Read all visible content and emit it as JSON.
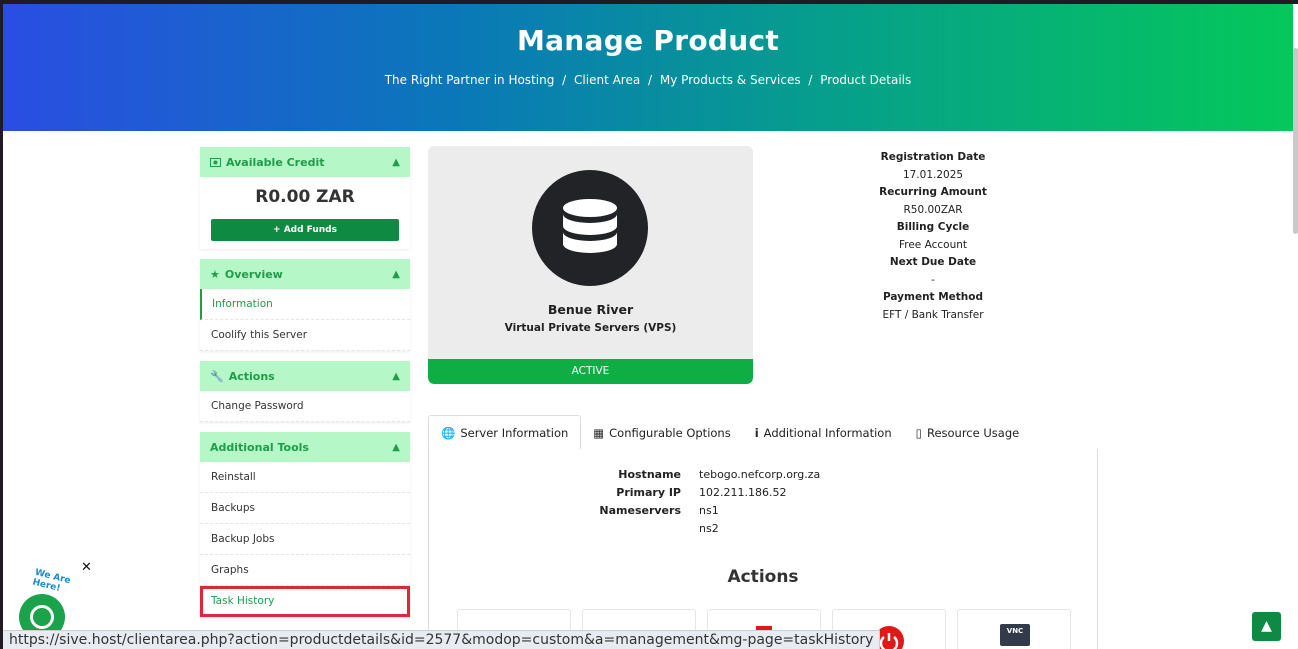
{
  "hero": {
    "title": "Manage Product",
    "breadcrumb": [
      "The Right Partner in Hosting",
      "Client Area",
      "My Products & Services",
      "Product Details"
    ],
    "separator": "/"
  },
  "sidebar": {
    "credit_panel": {
      "title": "Available Credit",
      "amount": "R0.00 ZAR",
      "button": "Add Funds"
    },
    "overview_panel": {
      "title": "Overview",
      "items": [
        "Information",
        "Coolify this Server"
      ]
    },
    "actions_panel": {
      "title": "Actions",
      "items": [
        "Change Password"
      ]
    },
    "tools_panel": {
      "title": "Additional Tools",
      "items": [
        "Reinstall",
        "Backups",
        "Backup Jobs",
        "Graphs",
        "Task History"
      ]
    }
  },
  "product": {
    "name": "Benue River",
    "group": "Virtual Private Servers (VPS)",
    "status": "ACTIVE"
  },
  "details": [
    {
      "label": "Registration Date",
      "value": "17.01.2025"
    },
    {
      "label": "Recurring Amount",
      "value": "R50.00ZAR"
    },
    {
      "label": "Billing Cycle",
      "value": "Free Account"
    },
    {
      "label": "Next Due Date",
      "value": "-"
    },
    {
      "label": "Payment Method",
      "value": "EFT / Bank Transfer"
    }
  ],
  "tabs": [
    "Server Information",
    "Configurable Options",
    "Additional Information",
    "Resource Usage"
  ],
  "server": {
    "hostname_label": "Hostname",
    "hostname": "tebogo.nefcorp.org.za",
    "ip_label": "Primary IP",
    "ip": "102.211.186.52",
    "ns_label": "Nameservers",
    "ns1": "ns1",
    "ns2": "ns2"
  },
  "actions_title": "Actions",
  "vnc_label": "VNC",
  "chat": {
    "label": "We Are Here!"
  },
  "status_url": "https://sive.host/clientarea.php?action=productdetails&id=2577&modop=custom&a=management&mg-page=taskHistory",
  "colors": {
    "accent": "#0f8a43",
    "panel_head": "#b5f7c6",
    "highlight": "#e0263a"
  }
}
